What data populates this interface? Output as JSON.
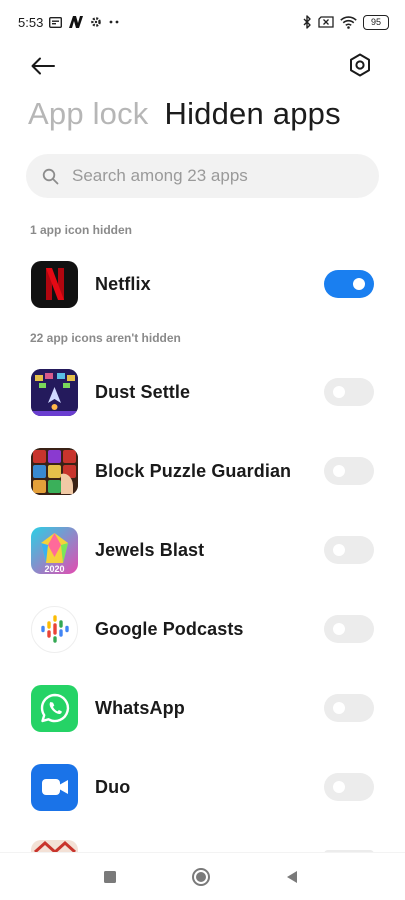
{
  "status_bar": {
    "time": "5:53",
    "battery": "95",
    "left_icons": [
      "screen-icon",
      "n-app-icon",
      "gear-icon",
      "more-dots-icon"
    ],
    "right_icons": [
      "bluetooth-icon",
      "no-sim-icon",
      "wifi-icon",
      "battery-icon"
    ]
  },
  "header": {
    "back_icon": "back-arrow-icon",
    "settings_icon": "settings-hex-icon"
  },
  "tabs": [
    {
      "label": "App lock",
      "active": false
    },
    {
      "label": "Hidden apps",
      "active": true
    }
  ],
  "search": {
    "placeholder": "Search among 23 apps",
    "value": ""
  },
  "sections": {
    "hidden_label": "1 app icon hidden",
    "not_hidden_label": "22 app icons aren't hidden"
  },
  "hidden_apps": [
    {
      "name": "Netflix",
      "icon": "netflix-icon",
      "hidden": true
    }
  ],
  "visible_apps": [
    {
      "name": "Dust Settle",
      "icon": "dust-settle-icon",
      "hidden": false
    },
    {
      "name": "Block Puzzle Guardian",
      "icon": "block-puzzle-icon",
      "hidden": false
    },
    {
      "name": "Jewels Blast",
      "icon": "jewels-blast-icon",
      "badge": "2020",
      "hidden": false
    },
    {
      "name": "Google Podcasts",
      "icon": "google-podcasts-icon",
      "hidden": false
    },
    {
      "name": "WhatsApp",
      "icon": "whatsapp-icon",
      "hidden": false
    },
    {
      "name": "Duo",
      "icon": "duo-icon",
      "hidden": false
    }
  ],
  "colors": {
    "toggle_on": "#1a7ff0",
    "toggle_off": "#ececec",
    "netflix_red": "#e50914",
    "whatsapp_green": "#25d366",
    "duo_blue": "#1a73e8"
  },
  "nav_bar": {
    "icons": [
      "recents-square-icon",
      "home-circle-icon",
      "back-triangle-icon"
    ]
  }
}
